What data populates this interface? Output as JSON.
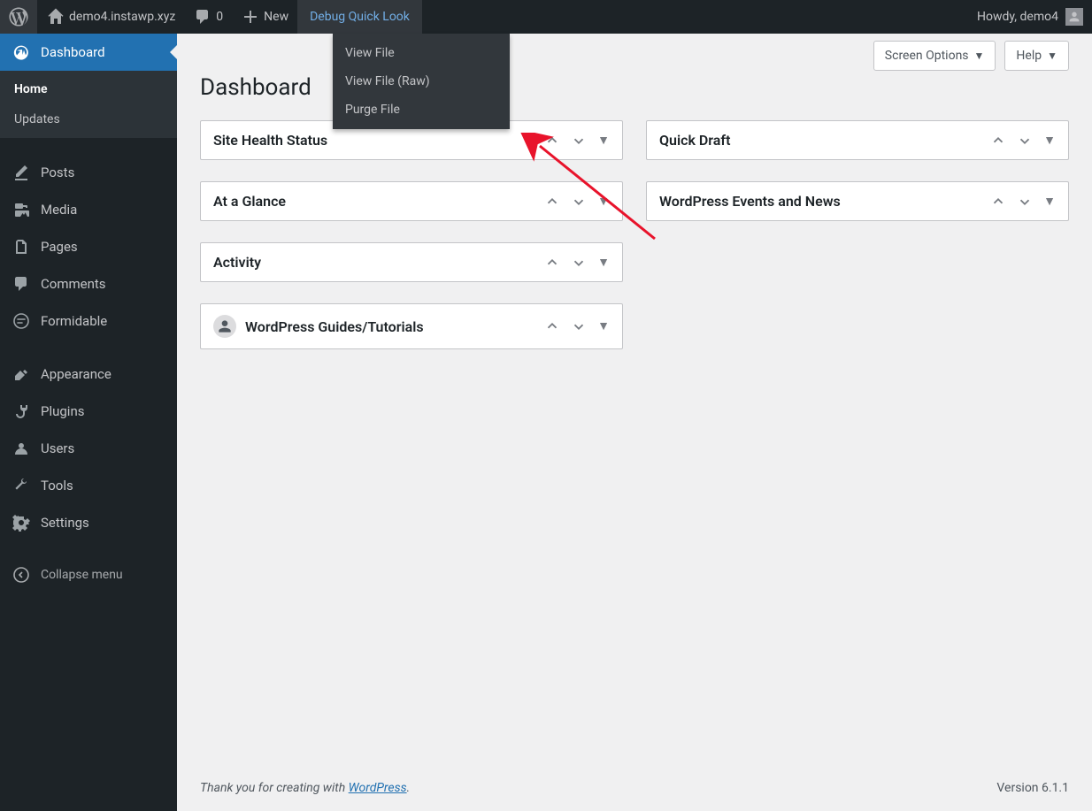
{
  "adminbar": {
    "site_name": "demo4.instawp.xyz",
    "comments_count": "0",
    "new_label": "New",
    "debug_label": "Debug Quick Look",
    "debug_submenu": [
      "View File",
      "View File (Raw)",
      "Purge File"
    ],
    "howdy": "Howdy, demo4"
  },
  "sidebar": {
    "items": [
      {
        "label": "Dashboard",
        "icon": "dashboard"
      },
      {
        "label": "Posts",
        "icon": "posts"
      },
      {
        "label": "Media",
        "icon": "media"
      },
      {
        "label": "Pages",
        "icon": "pages"
      },
      {
        "label": "Comments",
        "icon": "comments"
      },
      {
        "label": "Formidable",
        "icon": "formidable"
      },
      {
        "label": "Appearance",
        "icon": "appearance"
      },
      {
        "label": "Plugins",
        "icon": "plugins"
      },
      {
        "label": "Users",
        "icon": "users"
      },
      {
        "label": "Tools",
        "icon": "tools"
      },
      {
        "label": "Settings",
        "icon": "settings"
      }
    ],
    "dashboard_submenu": [
      "Home",
      "Updates"
    ],
    "collapse_label": "Collapse menu"
  },
  "page": {
    "title": "Dashboard",
    "screen_options": "Screen Options",
    "help": "Help"
  },
  "widgets": {
    "left": [
      {
        "title": "Site Health Status"
      },
      {
        "title": "At a Glance"
      },
      {
        "title": "Activity"
      },
      {
        "title": "WordPress Guides/Tutorials",
        "icon": true
      }
    ],
    "right": [
      {
        "title": "Quick Draft"
      },
      {
        "title": "WordPress Events and News"
      }
    ]
  },
  "footer": {
    "thanks_prefix": "Thank you for creating with ",
    "thanks_link": "WordPress",
    "thanks_suffix": ".",
    "version": "Version 6.1.1"
  }
}
